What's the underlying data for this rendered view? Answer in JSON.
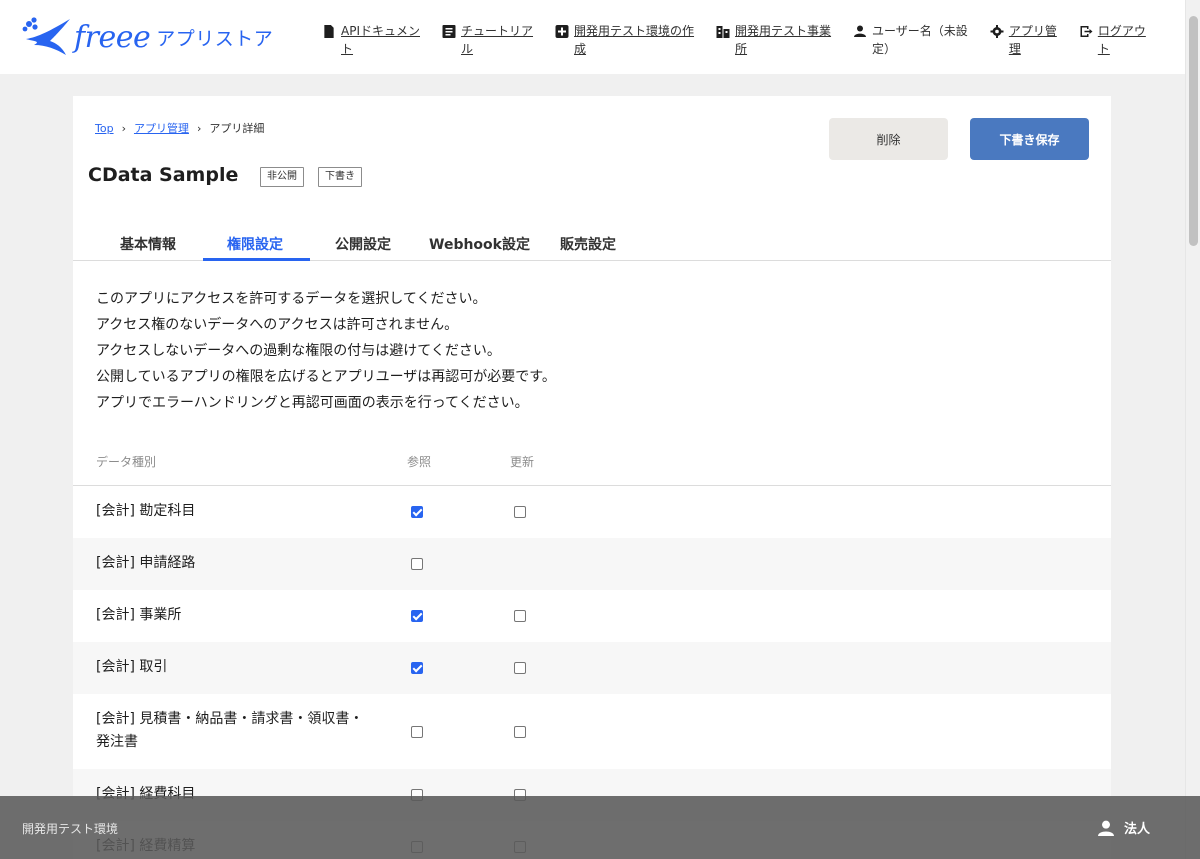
{
  "header": {
    "logo_freee": "freee",
    "logo_store": "アプリストア",
    "nav": [
      {
        "icon": "document-icon",
        "label_line1": "APIドキュメン",
        "label_line2": "ト"
      },
      {
        "icon": "book-icon",
        "label_line1": "チュートリア",
        "label_line2": "ル"
      },
      {
        "icon": "plus-box-icon",
        "label_line1": "開発用テスト環境の作",
        "label_line2": "成"
      },
      {
        "icon": "building-icon",
        "label_line1": "開発用テスト事業",
        "label_line2": "所"
      },
      {
        "icon": "user-icon",
        "label_line1": "ユーザー名（未設",
        "label_line2": "定）"
      },
      {
        "icon": "gear-icon",
        "label_line1": "アプリ管",
        "label_line2": "理"
      },
      {
        "icon": "logout-icon",
        "label_line1": "ログアウ",
        "label_line2": "ト"
      }
    ]
  },
  "breadcrumb": {
    "top": "Top",
    "apps": "アプリ管理",
    "current": "アプリ詳細"
  },
  "app": {
    "title": "CData Sample",
    "badge_private": "非公開",
    "badge_draft": "下書き"
  },
  "actions": {
    "delete": "削除",
    "save_draft": "下書き保存"
  },
  "tabs": [
    "基本情報",
    "権限設定",
    "公開設定",
    "Webhook設定",
    "販売設定"
  ],
  "active_tab": "権限設定",
  "description": [
    "このアプリにアクセスを許可するデータを選択してください。",
    "アクセス権のないデータへのアクセスは許可されません。",
    "アクセスしないデータへの過剰な権限の付与は避けてください。",
    "公開しているアプリの権限を広げるとアプリユーザは再認可が必要です。",
    "アプリでエラーハンドリングと再認可画面の表示を行ってください。"
  ],
  "table": {
    "headers": {
      "type": "データ種別",
      "read": "参照",
      "write": "更新"
    },
    "rows": [
      {
        "name": "[会計] 勘定科目",
        "read": true,
        "write": false,
        "has_write": true
      },
      {
        "name": "[会計] 申請経路",
        "read": false,
        "write": false,
        "has_write": false
      },
      {
        "name": "[会計] 事業所",
        "read": true,
        "write": false,
        "has_write": true
      },
      {
        "name": "[会計] 取引",
        "read": true,
        "write": false,
        "has_write": true
      },
      {
        "name": "[会計] 見積書・納品書・請求書・領収書・発注書",
        "read": false,
        "write": false,
        "has_write": true
      },
      {
        "name": "[会計] 経費科目",
        "read": false,
        "write": false,
        "has_write": true
      },
      {
        "name": "[会計] 経費精算",
        "read": false,
        "write": false,
        "has_write": true
      }
    ]
  },
  "footer": {
    "env_label": "開発用テスト環境",
    "user_type": "法人"
  },
  "colors": {
    "brand": "#2864f0",
    "save_button": "#4a79c0",
    "footer_bg": "#5a5a5a"
  }
}
